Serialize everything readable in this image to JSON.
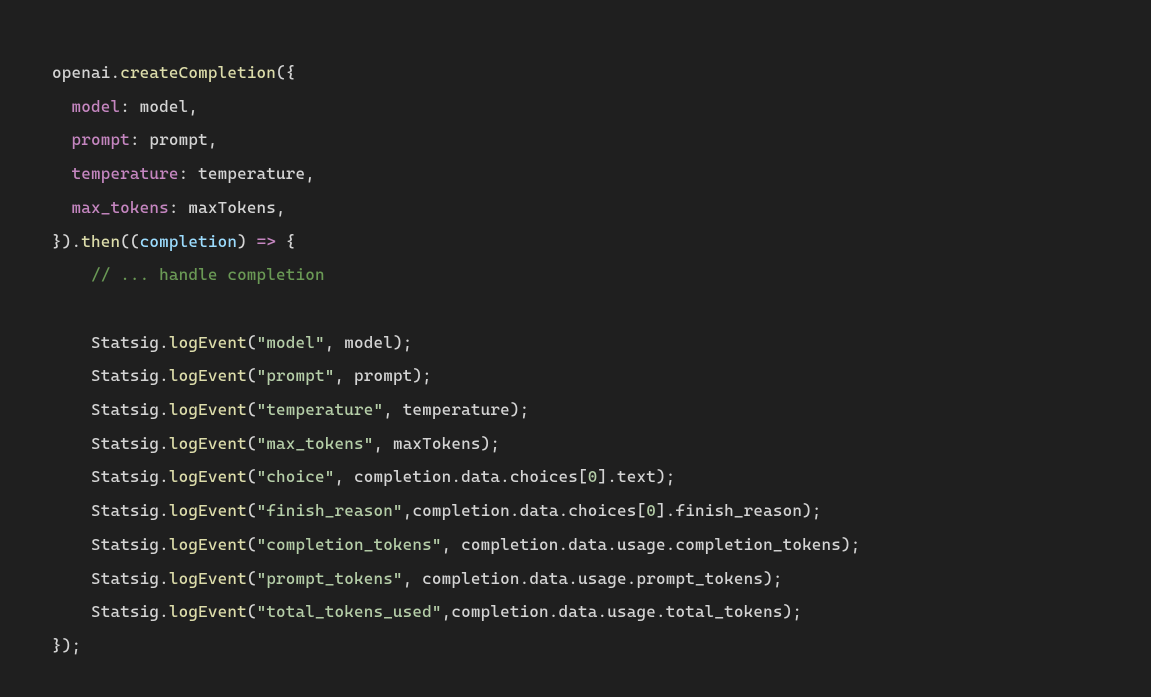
{
  "code": {
    "lines": [
      {
        "indent": 0,
        "tokens": [
          {
            "c": "obj",
            "t": "openai"
          },
          {
            "c": "punct",
            "t": "."
          },
          {
            "c": "func",
            "t": "createCompletion"
          },
          {
            "c": "punct",
            "t": "({"
          }
        ]
      },
      {
        "indent": 1,
        "tokens": [
          {
            "c": "key",
            "t": "model"
          },
          {
            "c": "punct",
            "t": ": "
          },
          {
            "c": "obj",
            "t": "model"
          },
          {
            "c": "punct",
            "t": ","
          }
        ]
      },
      {
        "indent": 1,
        "tokens": [
          {
            "c": "key",
            "t": "prompt"
          },
          {
            "c": "punct",
            "t": ": "
          },
          {
            "c": "obj",
            "t": "prompt"
          },
          {
            "c": "punct",
            "t": ","
          }
        ]
      },
      {
        "indent": 1,
        "tokens": [
          {
            "c": "key",
            "t": "temperature"
          },
          {
            "c": "punct",
            "t": ": "
          },
          {
            "c": "obj",
            "t": "temperature"
          },
          {
            "c": "punct",
            "t": ","
          }
        ]
      },
      {
        "indent": 1,
        "tokens": [
          {
            "c": "key",
            "t": "max_tokens"
          },
          {
            "c": "punct",
            "t": ": "
          },
          {
            "c": "obj",
            "t": "maxTokens"
          },
          {
            "c": "punct",
            "t": ","
          }
        ]
      },
      {
        "indent": 0,
        "tokens": [
          {
            "c": "punct",
            "t": "})."
          },
          {
            "c": "func",
            "t": "then"
          },
          {
            "c": "punct",
            "t": "(("
          },
          {
            "c": "var",
            "t": "completion"
          },
          {
            "c": "punct",
            "t": ") "
          },
          {
            "c": "key",
            "t": "=>"
          },
          {
            "c": "punct",
            "t": " {"
          }
        ]
      },
      {
        "indent": 2,
        "tokens": [
          {
            "c": "comment",
            "t": "// ... handle completion"
          }
        ]
      },
      {
        "indent": 0,
        "tokens": []
      },
      {
        "indent": 2,
        "tokens": [
          {
            "c": "obj",
            "t": "Statsig"
          },
          {
            "c": "punct",
            "t": "."
          },
          {
            "c": "func",
            "t": "logEvent"
          },
          {
            "c": "punct",
            "t": "("
          },
          {
            "c": "string",
            "t": "\"model\""
          },
          {
            "c": "punct",
            "t": ", "
          },
          {
            "c": "obj",
            "t": "model"
          },
          {
            "c": "punct",
            "t": ");"
          }
        ]
      },
      {
        "indent": 2,
        "tokens": [
          {
            "c": "obj",
            "t": "Statsig"
          },
          {
            "c": "punct",
            "t": "."
          },
          {
            "c": "func",
            "t": "logEvent"
          },
          {
            "c": "punct",
            "t": "("
          },
          {
            "c": "string",
            "t": "\"prompt\""
          },
          {
            "c": "punct",
            "t": ", "
          },
          {
            "c": "obj",
            "t": "prompt"
          },
          {
            "c": "punct",
            "t": ");"
          }
        ]
      },
      {
        "indent": 2,
        "tokens": [
          {
            "c": "obj",
            "t": "Statsig"
          },
          {
            "c": "punct",
            "t": "."
          },
          {
            "c": "func",
            "t": "logEvent"
          },
          {
            "c": "punct",
            "t": "("
          },
          {
            "c": "string",
            "t": "\"temperature\""
          },
          {
            "c": "punct",
            "t": ", "
          },
          {
            "c": "obj",
            "t": "temperature"
          },
          {
            "c": "punct",
            "t": ");"
          }
        ]
      },
      {
        "indent": 2,
        "tokens": [
          {
            "c": "obj",
            "t": "Statsig"
          },
          {
            "c": "punct",
            "t": "."
          },
          {
            "c": "func",
            "t": "logEvent"
          },
          {
            "c": "punct",
            "t": "("
          },
          {
            "c": "string",
            "t": "\"max_tokens\""
          },
          {
            "c": "punct",
            "t": ", "
          },
          {
            "c": "obj",
            "t": "maxTokens"
          },
          {
            "c": "punct",
            "t": ");"
          }
        ]
      },
      {
        "indent": 2,
        "tokens": [
          {
            "c": "obj",
            "t": "Statsig"
          },
          {
            "c": "punct",
            "t": "."
          },
          {
            "c": "func",
            "t": "logEvent"
          },
          {
            "c": "punct",
            "t": "("
          },
          {
            "c": "string",
            "t": "\"choice\""
          },
          {
            "c": "punct",
            "t": ", "
          },
          {
            "c": "obj",
            "t": "completion"
          },
          {
            "c": "punct",
            "t": "."
          },
          {
            "c": "obj",
            "t": "data"
          },
          {
            "c": "punct",
            "t": "."
          },
          {
            "c": "obj",
            "t": "choices"
          },
          {
            "c": "punct",
            "t": "["
          },
          {
            "c": "num",
            "t": "0"
          },
          {
            "c": "punct",
            "t": "]."
          },
          {
            "c": "obj",
            "t": "text"
          },
          {
            "c": "punct",
            "t": ");"
          }
        ]
      },
      {
        "indent": 2,
        "tokens": [
          {
            "c": "obj",
            "t": "Statsig"
          },
          {
            "c": "punct",
            "t": "."
          },
          {
            "c": "func",
            "t": "logEvent"
          },
          {
            "c": "punct",
            "t": "("
          },
          {
            "c": "string",
            "t": "\"finish_reason\""
          },
          {
            "c": "punct",
            "t": ","
          },
          {
            "c": "obj",
            "t": "completion"
          },
          {
            "c": "punct",
            "t": "."
          },
          {
            "c": "obj",
            "t": "data"
          },
          {
            "c": "punct",
            "t": "."
          },
          {
            "c": "obj",
            "t": "choices"
          },
          {
            "c": "punct",
            "t": "["
          },
          {
            "c": "num",
            "t": "0"
          },
          {
            "c": "punct",
            "t": "]."
          },
          {
            "c": "obj",
            "t": "finish_reason"
          },
          {
            "c": "punct",
            "t": ");"
          }
        ]
      },
      {
        "indent": 2,
        "tokens": [
          {
            "c": "obj",
            "t": "Statsig"
          },
          {
            "c": "punct",
            "t": "."
          },
          {
            "c": "func",
            "t": "logEvent"
          },
          {
            "c": "punct",
            "t": "("
          },
          {
            "c": "string",
            "t": "\"completion_tokens\""
          },
          {
            "c": "punct",
            "t": ", "
          },
          {
            "c": "obj",
            "t": "completion"
          },
          {
            "c": "punct",
            "t": "."
          },
          {
            "c": "obj",
            "t": "data"
          },
          {
            "c": "punct",
            "t": "."
          },
          {
            "c": "obj",
            "t": "usage"
          },
          {
            "c": "punct",
            "t": "."
          },
          {
            "c": "obj",
            "t": "completion_tokens"
          },
          {
            "c": "punct",
            "t": ");"
          }
        ]
      },
      {
        "indent": 2,
        "tokens": [
          {
            "c": "obj",
            "t": "Statsig"
          },
          {
            "c": "punct",
            "t": "."
          },
          {
            "c": "func",
            "t": "logEvent"
          },
          {
            "c": "punct",
            "t": "("
          },
          {
            "c": "string",
            "t": "\"prompt_tokens\""
          },
          {
            "c": "punct",
            "t": ", "
          },
          {
            "c": "obj",
            "t": "completion"
          },
          {
            "c": "punct",
            "t": "."
          },
          {
            "c": "obj",
            "t": "data"
          },
          {
            "c": "punct",
            "t": "."
          },
          {
            "c": "obj",
            "t": "usage"
          },
          {
            "c": "punct",
            "t": "."
          },
          {
            "c": "obj",
            "t": "prompt_tokens"
          },
          {
            "c": "punct",
            "t": ");"
          }
        ]
      },
      {
        "indent": 2,
        "tokens": [
          {
            "c": "obj",
            "t": "Statsig"
          },
          {
            "c": "punct",
            "t": "."
          },
          {
            "c": "func",
            "t": "logEvent"
          },
          {
            "c": "punct",
            "t": "("
          },
          {
            "c": "string",
            "t": "\"total_tokens_used\""
          },
          {
            "c": "punct",
            "t": ","
          },
          {
            "c": "obj",
            "t": "completion"
          },
          {
            "c": "punct",
            "t": "."
          },
          {
            "c": "obj",
            "t": "data"
          },
          {
            "c": "punct",
            "t": "."
          },
          {
            "c": "obj",
            "t": "usage"
          },
          {
            "c": "punct",
            "t": "."
          },
          {
            "c": "obj",
            "t": "total_tokens"
          },
          {
            "c": "punct",
            "t": ");"
          }
        ]
      },
      {
        "indent": 0,
        "tokens": [
          {
            "c": "punct",
            "t": "});"
          }
        ]
      }
    ]
  }
}
